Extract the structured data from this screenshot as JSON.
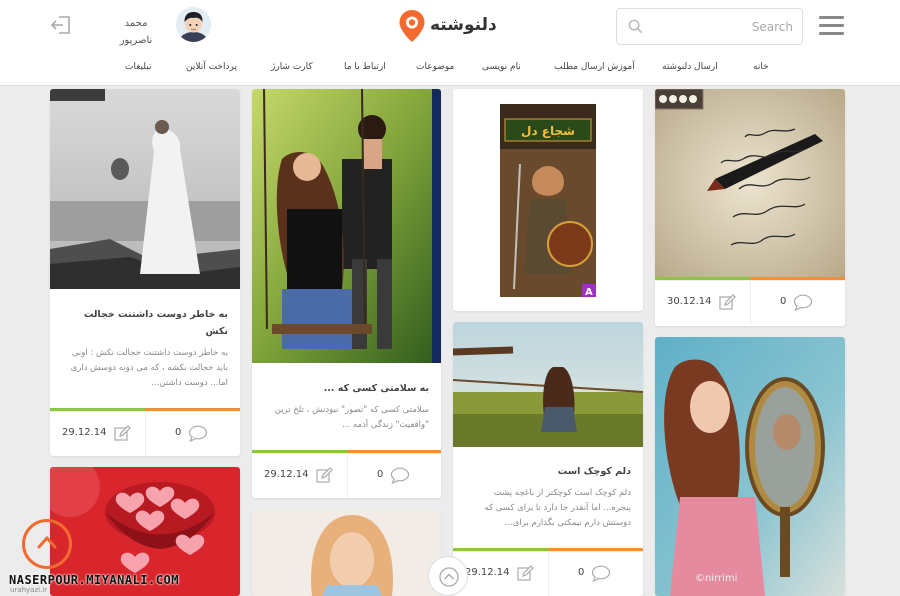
{
  "header": {
    "logo_text": "دلنوشته",
    "search_placeholder": "Search",
    "user_name_line1": "محمد",
    "user_name_line2": "ناصرپور"
  },
  "nav": {
    "items": [
      {
        "label": "خانه"
      },
      {
        "label": "ارسال دلنوشته"
      },
      {
        "label": "آموزش ارسال مطلب"
      },
      {
        "label": "نام نویسی"
      },
      {
        "label": "موضوعات"
      },
      {
        "label": "ارتباط با ما"
      },
      {
        "label": "کارت شارژ"
      },
      {
        "label": "پرداخت آنلاین"
      },
      {
        "label": "تبلیغات"
      }
    ]
  },
  "cards": {
    "wedding": {
      "title": "به خاطر دوست داشتنت خجالت نکش",
      "excerpt": "به خاطر دوست داشتنت خجالت نکش : اونی باید خجالت بکشه ، که می دونه دوسش داری اما... دوست داشتن...",
      "date": "29.12.14",
      "comments": "0"
    },
    "swing": {
      "title": "به سلامتی کسی که ...",
      "excerpt": "سلامتی کسی که \"تصور\" نبودنش ، تلخ ترین \"واقعیت\" زندگی آدمه ...",
      "date": "29.12.14",
      "comments": "0"
    },
    "game": {
      "game_title": "شجاع دل",
      "badge": "A"
    },
    "girl_field": {
      "title": "دلم کوچک است",
      "excerpt": "دلم کوچک است کوچکتر از باغچه پشت پنجره... اما آنقدر جا دارد تا برای کسی که دوستش دارم نیمکتی بگذارم برای...",
      "date": "29.12.14",
      "comments": "0"
    },
    "handwriting": {
      "date": "30.12.14",
      "comments": "0"
    },
    "mirror": {
      "photo_credit": "©nirrimi"
    }
  },
  "footer": {
    "watermark": "NASERPOUR.MIYANALI.COM",
    "site_mark": "urahyazi.ir"
  },
  "colors": {
    "accent_orange": "#f39033",
    "accent_green": "#8cc63f",
    "logo_pin": "#f26a2f"
  }
}
